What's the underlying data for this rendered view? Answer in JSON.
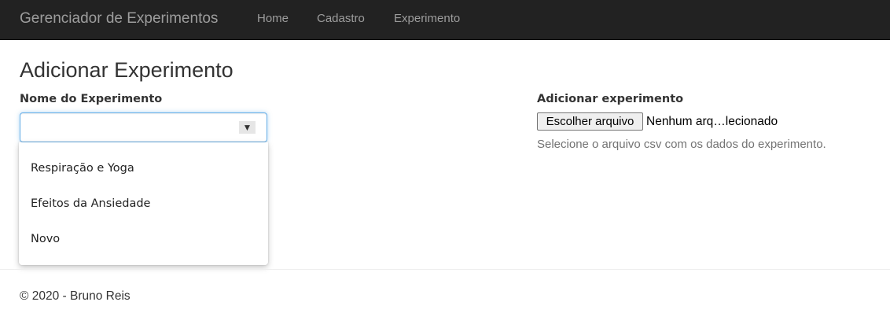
{
  "navbar": {
    "brand": "Gerenciador de Experimentos",
    "links": [
      "Home",
      "Cadastro",
      "Experimento"
    ]
  },
  "page": {
    "title": "Adicionar Experimento"
  },
  "form": {
    "name_label": "Nome do Experimento",
    "select_value": "",
    "select_arrow": "▼",
    "options": [
      "Respiração e Yoga",
      "Efeitos da Ansiedade",
      "Novo"
    ],
    "file_label": "Adicionar experimento",
    "file_button": "Escolher arquivo",
    "file_status": "Nenhum arq…lecionado",
    "help_text": "Selecione o arquivo csv com os dados do experimento."
  },
  "footer": {
    "text": "© 2020 - Bruno Reis"
  }
}
